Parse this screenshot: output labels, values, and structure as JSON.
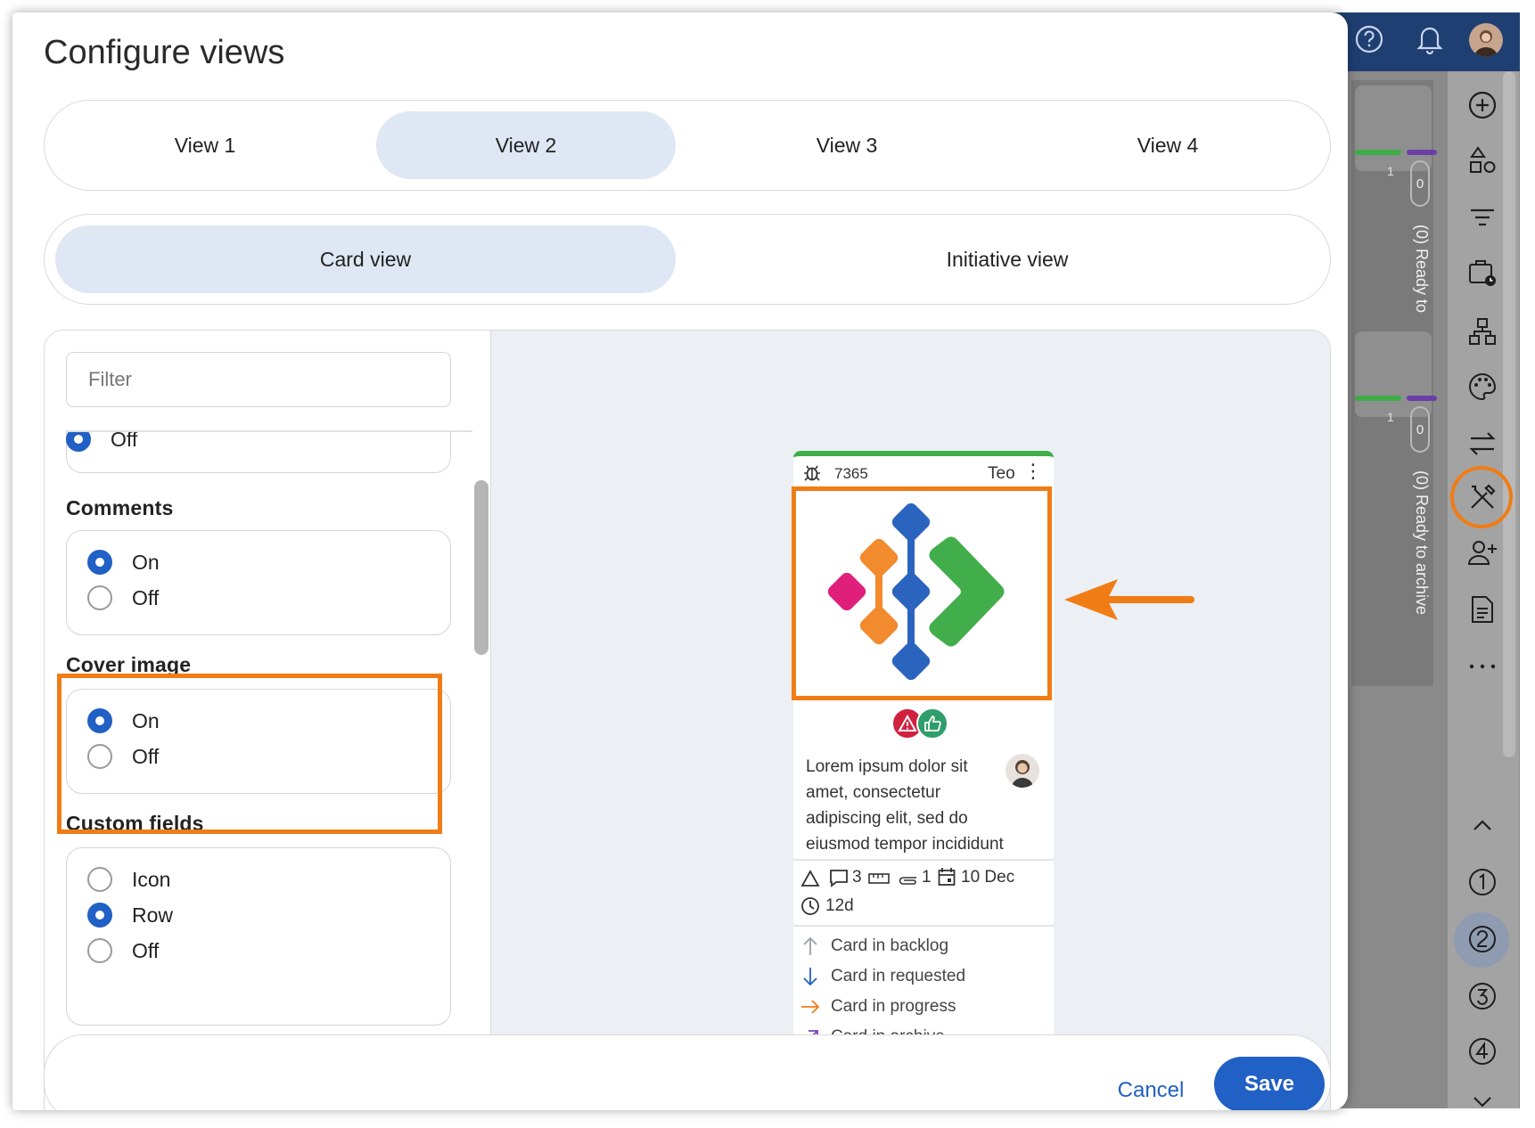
{
  "dialog": {
    "title": "Configure views",
    "view_tabs": [
      {
        "label": "View 1",
        "active": false
      },
      {
        "label": "View 2",
        "active": true
      },
      {
        "label": "View 3",
        "active": false
      },
      {
        "label": "View 4",
        "active": false
      }
    ],
    "mode_tabs": [
      {
        "label": "Card view",
        "active": true
      },
      {
        "label": "Initiative view",
        "active": false
      }
    ],
    "filter": {
      "placeholder": "Filter",
      "value": ""
    },
    "sections": {
      "partial_option": {
        "label": "Off",
        "checked": true
      },
      "comments": {
        "title": "Comments",
        "options": [
          {
            "label": "On",
            "checked": true
          },
          {
            "label": "Off",
            "checked": false
          }
        ]
      },
      "cover_image": {
        "title": "Cover image",
        "options": [
          {
            "label": "On",
            "checked": true
          },
          {
            "label": "Off",
            "checked": false
          }
        ]
      },
      "custom_fields": {
        "title": "Custom fields",
        "options": [
          {
            "label": "Icon",
            "checked": false
          },
          {
            "label": "Row",
            "checked": true
          },
          {
            "label": "Off",
            "checked": false
          }
        ]
      }
    },
    "footer": {
      "cancel_label": "Cancel",
      "save_label": "Save"
    }
  },
  "preview_card": {
    "accent_color": "#3fae49",
    "id": "7365",
    "owner": "Teo",
    "menu_glyph": "⋮",
    "description": "Lorem ipsum dolor sit amet, consectetur adipiscing elit, sed do eiusmod tempor incididunt",
    "meta": {
      "comments": "3",
      "attachments": "1",
      "due_date": "10 Dec",
      "age": "12d"
    },
    "relations": [
      {
        "label": "Card in backlog",
        "icon": "arrow-up-icon",
        "color": "#9aa0a6"
      },
      {
        "label": "Card in requested",
        "icon": "arrow-down-icon",
        "color": "#2160c4"
      },
      {
        "label": "Card in progress",
        "icon": "arrow-right-icon",
        "color": "#f07c16"
      },
      {
        "label": "Card in archive",
        "icon": "arrow-up-right-icon",
        "color": "#7b3fb5"
      }
    ],
    "badges": [
      {
        "icon": "warning-icon",
        "color": "#d1213f"
      },
      {
        "icon": "thumbs-up-icon",
        "color": "#2e9e6a"
      }
    ]
  },
  "background_board": {
    "lane_counts": [
      "1",
      "0",
      "1",
      "0"
    ],
    "lane_titles": [
      "(0) Ready to",
      "(0) Ready to archive"
    ],
    "rail_icons": [
      "plus-circle-icon",
      "shapes-icon",
      "filter-icon",
      "calendar-clock-icon",
      "hierarchy-icon",
      "palette-icon",
      "swap-icon",
      "tools-icon",
      "add-user-icon",
      "document-icon",
      "more-icon",
      "chevron-up-icon",
      "view-1-icon",
      "view-2-icon",
      "view-3-icon",
      "view-4-icon",
      "chevron-down-icon"
    ],
    "highlight_color": "#f07c16"
  }
}
